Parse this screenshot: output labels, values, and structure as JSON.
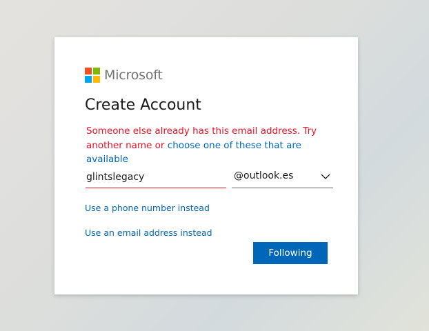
{
  "logo": {
    "text": "Microsoft",
    "colors": [
      "#f25022",
      "#7fba00",
      "#00a4ef",
      "#ffb900"
    ]
  },
  "title": "Create Account",
  "error": {
    "message_prefix": "Someone else already has this email address. Try another name or ",
    "suggestion_link": "choose one of these that are available"
  },
  "form": {
    "username_value": "glintslegacy",
    "domain_value": "@outlook.es"
  },
  "links": {
    "phone": "Use a phone number instead",
    "email": "Use an email address instead"
  },
  "buttons": {
    "next_label": "Following"
  },
  "colors": {
    "accent": "#0067b8",
    "error": "#e81123"
  },
  "icons": {
    "dropdown": "chevron-down-icon"
  }
}
